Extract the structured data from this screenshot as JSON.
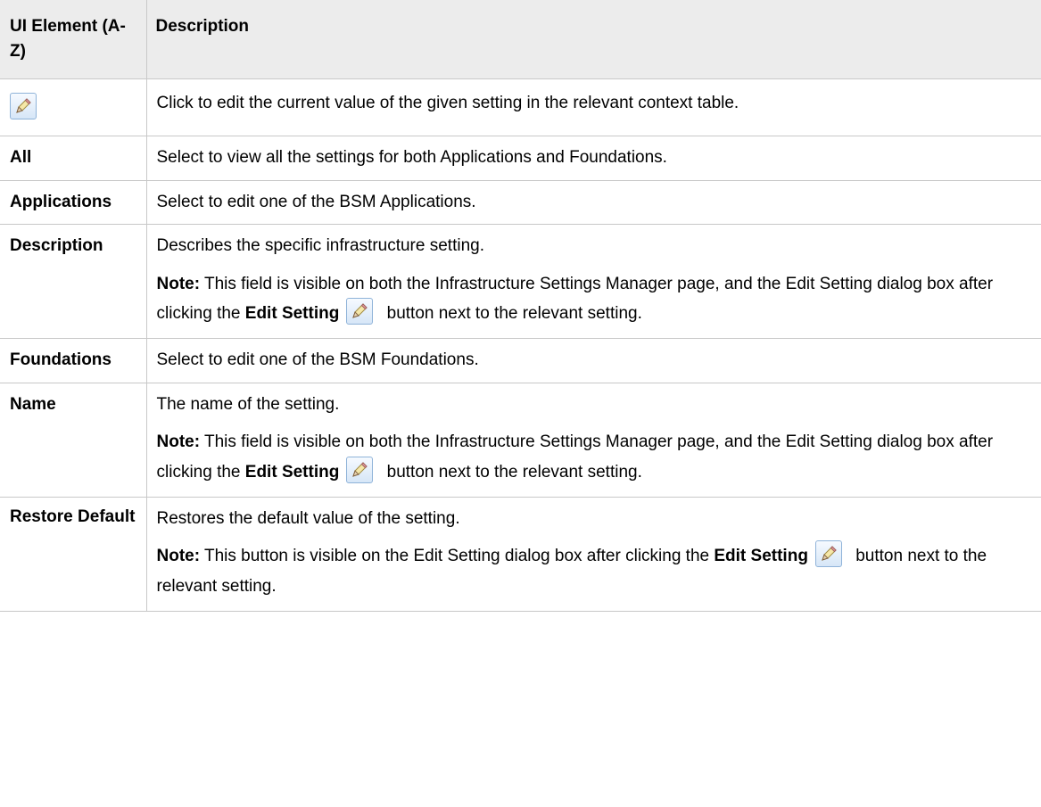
{
  "table": {
    "header": {
      "col1": "UI Element (A-Z)",
      "col2": "Description"
    },
    "rows": {
      "edit": {
        "icon": "pencil-edit-icon",
        "description": "Click to edit the current value of the given setting in the relevant context table."
      },
      "all": {
        "name": "All",
        "description": "Select to view all the settings for both Applications and Foundations."
      },
      "applications": {
        "name": "Applications",
        "description": "Select to edit one of the BSM Applications."
      },
      "description": {
        "name": "Description",
        "description": "Describes the specific infrastructure setting.",
        "note_label": "Note:",
        "note_text_1": " This field is visible on both the Infrastructure Settings Manager page, and the Edit Setting dialog box after clicking the ",
        "note_bold": "Edit Setting",
        "note_text_2": " button next to the relevant setting."
      },
      "foundations": {
        "name": "Foundations",
        "description": "Select to edit one of the BSM Foundations."
      },
      "name": {
        "name": "Name",
        "description": "The name of the setting.",
        "note_label": "Note:",
        "note_text_1": " This field is visible on both the Infrastructure Settings Manager page, and the Edit Setting dialog box after clicking the ",
        "note_bold": "Edit Setting",
        "note_text_2": " button next to the relevant setting."
      },
      "restore": {
        "name": "Restore Default",
        "description": "Restores the default value of the setting.",
        "note_label": "Note:",
        "note_text_1": " This button is visible on the Edit Setting dialog box after clicking the ",
        "note_bold": "Edit Setting",
        "note_text_2": " button next to the relevant setting."
      }
    }
  },
  "colors": {
    "header_bg": "#ececec",
    "border": "#c8c8c8",
    "icon_border": "#8fb3d9"
  }
}
